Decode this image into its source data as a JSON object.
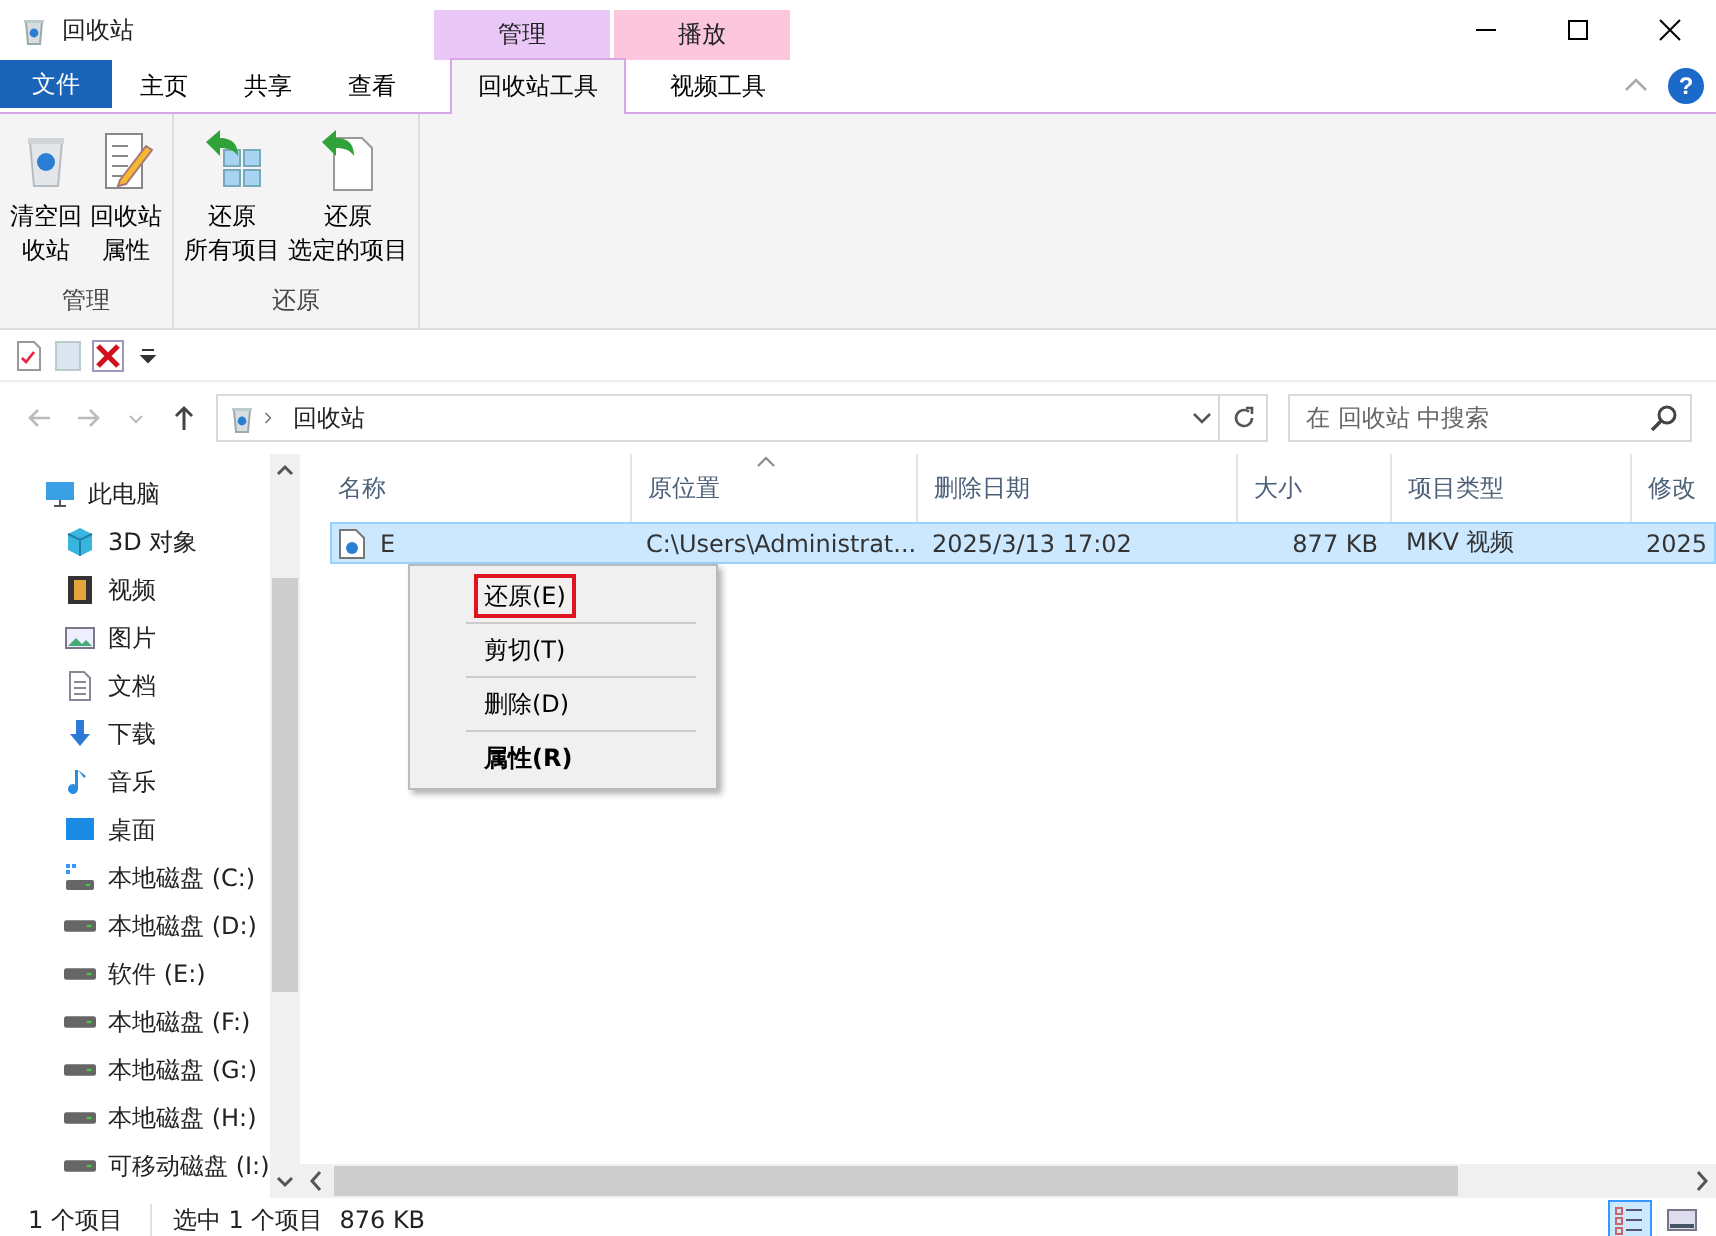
{
  "window": {
    "title": "回收站"
  },
  "ribbon_tabs": [
    {
      "label": "文件",
      "kind": "file",
      "selected": false
    },
    {
      "label": "主页",
      "kind": "plain",
      "selected": false
    },
    {
      "label": "共享",
      "kind": "plain",
      "selected": false
    },
    {
      "label": "查看",
      "kind": "plain",
      "selected": false
    },
    {
      "label": "回收站工具",
      "kind": "context",
      "group": "管理",
      "color": "#e9c7f7",
      "selected": true
    },
    {
      "label": "视频工具",
      "kind": "context",
      "group": "播放",
      "color": "#fcc7dd",
      "selected": false
    }
  ],
  "ribbon_groups": [
    {
      "label": "管理",
      "buttons": [
        {
          "lines": [
            "清空回",
            "收站"
          ],
          "kind": "bin"
        },
        {
          "lines": [
            "回收站",
            "属性"
          ],
          "kind": "props"
        }
      ]
    },
    {
      "label": "还原",
      "buttons": [
        {
          "lines": [
            "还原",
            "所有项目"
          ],
          "kind": "restore-all"
        },
        {
          "lines": [
            "还原",
            "选定的项目"
          ],
          "kind": "restore-one"
        }
      ]
    }
  ],
  "help": {
    "label": "?"
  },
  "address": {
    "path": "回收站"
  },
  "search": {
    "placeholder": "在 回收站 中搜索"
  },
  "nav_items": [
    {
      "label": "此电脑",
      "kind": "pc"
    },
    {
      "label": "3D 对象",
      "kind": "cube"
    },
    {
      "label": "视频",
      "kind": "film"
    },
    {
      "label": "图片",
      "kind": "picture"
    },
    {
      "label": "文档",
      "kind": "doc"
    },
    {
      "label": "下载",
      "kind": "download"
    },
    {
      "label": "音乐",
      "kind": "music"
    },
    {
      "label": "桌面",
      "kind": "desktop"
    },
    {
      "label": "本地磁盘 (C:)",
      "kind": "sysdrive"
    },
    {
      "label": "本地磁盘 (D:)",
      "kind": "drive"
    },
    {
      "label": "软件 (E:)",
      "kind": "drive"
    },
    {
      "label": "本地磁盘 (F:)",
      "kind": "drive"
    },
    {
      "label": "本地磁盘 (G:)",
      "kind": "drive"
    },
    {
      "label": "本地磁盘 (H:)",
      "kind": "drive"
    },
    {
      "label": "可移动磁盘 (I:)",
      "kind": "drive"
    }
  ],
  "columns": [
    {
      "label": "名称",
      "sorted": false
    },
    {
      "label": "原位置",
      "sorted": true
    },
    {
      "label": "删除日期",
      "sorted": false
    },
    {
      "label": "大小",
      "sorted": false
    },
    {
      "label": "项目类型",
      "sorted": false
    },
    {
      "label": "修改",
      "sorted": false
    }
  ],
  "rows": [
    {
      "selected": true,
      "cells": [
        "E",
        "C:\\Users\\Administrat...",
        "2025/3/13 17:02",
        "877 KB",
        "MKV 视频",
        "2025"
      ]
    }
  ],
  "context_menu": [
    {
      "label": "还原(E)",
      "highlighted": true,
      "default": false
    },
    {
      "label": "剪切(T)",
      "highlighted": false,
      "default": false
    },
    {
      "label": "删除(D)",
      "highlighted": false,
      "default": false
    },
    {
      "label": "属性(R)",
      "highlighted": false,
      "default": true
    }
  ],
  "status_bar": {
    "count": "1 个项目",
    "selection": "选中 1 个项目",
    "size": "876 KB"
  },
  "views": [
    {
      "kind": "details",
      "selected": true
    },
    {
      "kind": "tiles",
      "selected": false
    }
  ]
}
